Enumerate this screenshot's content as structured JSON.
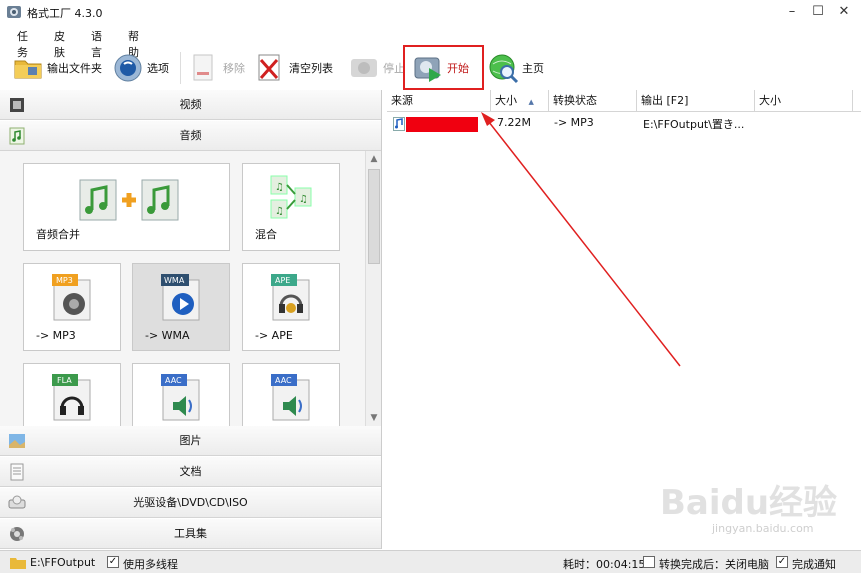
{
  "window": {
    "title": "格式工厂 4.3.0"
  },
  "menu": [
    "任务",
    "皮肤",
    "语言",
    "帮助"
  ],
  "toolbar": {
    "output_folder": "输出文件夹",
    "options": "选项",
    "remove": "移除",
    "clear_list": "清空列表",
    "stop": "停止",
    "start": "开始",
    "home": "主页"
  },
  "categories": {
    "video": "视频",
    "audio": "音频",
    "picture": "图片",
    "document": "文档",
    "rom": "光驱设备\\DVD\\CD\\ISO",
    "tools": "工具集"
  },
  "tiles": [
    {
      "label": "音频合并"
    },
    {
      "label": "混合"
    },
    {
      "label": "-> MP3",
      "badge": "MP3"
    },
    {
      "label": "-> WMA",
      "badge": "WMA"
    },
    {
      "label": "-> APE",
      "badge": "APE"
    },
    {
      "label": "",
      "badge": "FLA"
    },
    {
      "label": "",
      "badge": "AAC"
    },
    {
      "label": "",
      "badge": "AAC"
    }
  ],
  "list": {
    "columns": [
      "来源",
      "大小",
      "转换状态",
      "输出 [F2]",
      "大小"
    ],
    "rows": [
      {
        "source": "",
        "size": "7.22M",
        "status": "-> MP3",
        "output": "E:\\FFOutput\\置き...",
        "out_size": ""
      }
    ]
  },
  "status": {
    "folder": "E:\\FFOutput",
    "multithread": "使用多线程",
    "elapsed": "耗时：00:04:15",
    "after_done": "转换完成后：关闭电脑",
    "notify": "完成通知"
  },
  "watermark": {
    "brand": "Baidu经验",
    "url": "jingyan.baidu.com"
  },
  "colors": {
    "highlight": "#e02020",
    "redaction": "#f00010"
  }
}
